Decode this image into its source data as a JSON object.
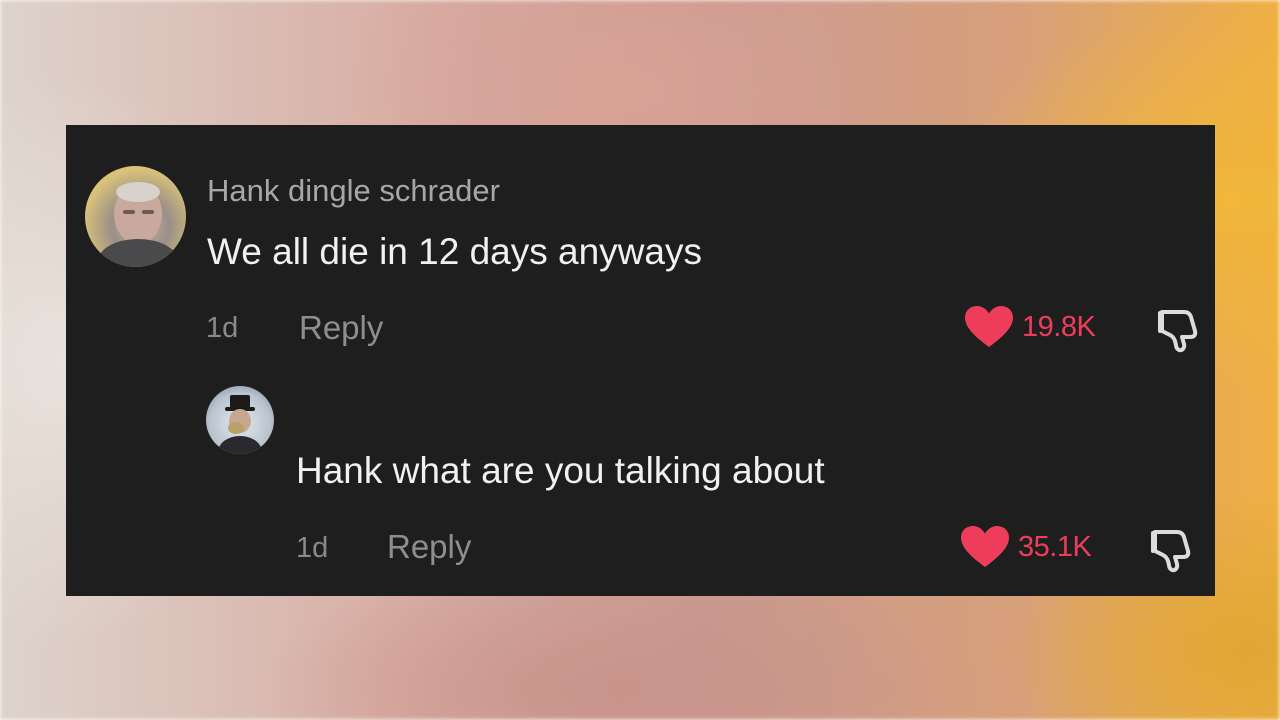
{
  "comments": [
    {
      "username": "Hank dingle schrader",
      "text": "We all die in 12 days anyways",
      "time": "1d",
      "reply_label": "Reply",
      "like_count": "19.8K",
      "liked": true
    },
    {
      "username": "",
      "text": "Hank what are you talking about",
      "time": "1d",
      "reply_label": "Reply",
      "like_count": "35.1K",
      "liked": true
    }
  ],
  "icons": {
    "like": "heart-icon",
    "dislike": "thumbs-down-icon"
  },
  "colors": {
    "panel_background": "#1e1e1e",
    "like_accent": "#ee3d5b",
    "comment_text": "#f1f1f1",
    "username_text": "#a7a7a7",
    "meta_text": "#8a8a8a"
  }
}
